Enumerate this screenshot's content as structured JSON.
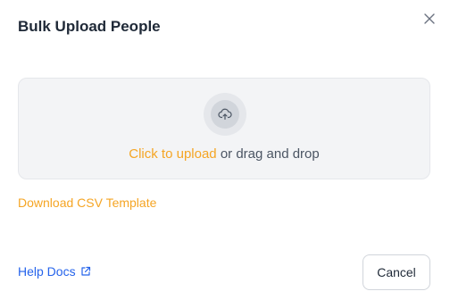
{
  "dialog": {
    "title": "Bulk Upload People"
  },
  "dropzone": {
    "click_text": "Click to upload",
    "rest_text": " or drag and drop",
    "icon": "cloud-upload-icon"
  },
  "links": {
    "download_csv": "Download CSV Template",
    "help_docs": "Help Docs"
  },
  "buttons": {
    "cancel": "Cancel"
  },
  "colors": {
    "accent": "#f5a524",
    "link_blue": "#2563eb",
    "dropzone_bg": "#f3f4f6"
  }
}
